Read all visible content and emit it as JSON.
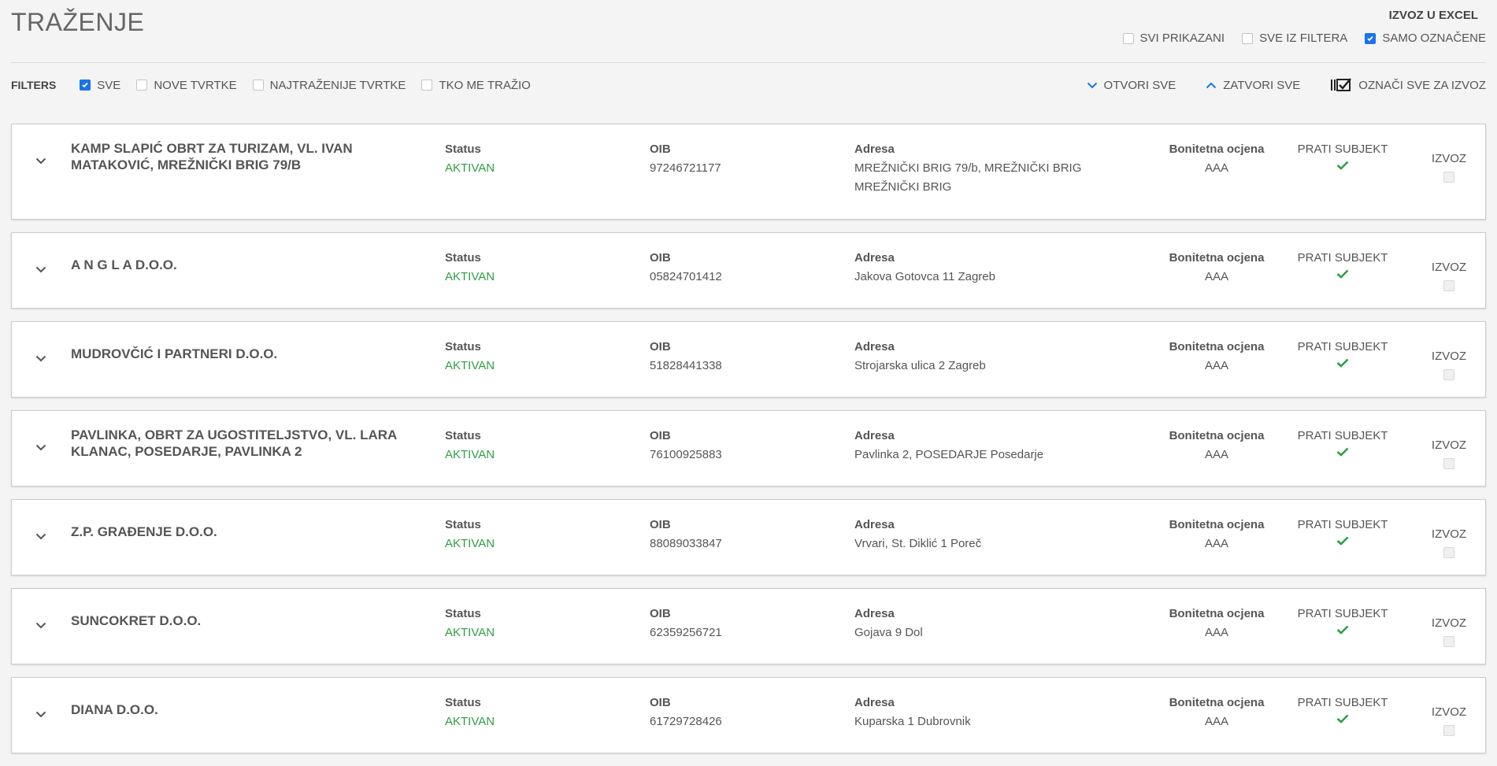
{
  "header": {
    "title": "TRAŽENJE",
    "export_title": "IZVOZ U EXCEL",
    "export_options": [
      {
        "label": "SVI PRIKAZANI",
        "checked": false
      },
      {
        "label": "SVE IZ FILTERA",
        "checked": false
      },
      {
        "label": "SAMO OZNAČENE",
        "checked": true
      }
    ]
  },
  "filters": {
    "label": "FILTERS",
    "items": [
      {
        "label": "SVE",
        "checked": true
      },
      {
        "label": "NOVE TVRTKE",
        "checked": false
      },
      {
        "label": "NAJTRAŽENIJE TVRTKE",
        "checked": false
      },
      {
        "label": "TKO ME TRAŽIO",
        "checked": false
      }
    ],
    "actions": {
      "open_all": "OTVORI SVE",
      "close_all": "ZATVORI SVE",
      "mark_all": "OZNAČI SVE ZA IZVOZ"
    }
  },
  "labels": {
    "status": "Status",
    "oib": "OIB",
    "address": "Adresa",
    "rating": "Bonitetna ocjena",
    "track": "PRATI SUBJEKT",
    "export": "IZVOZ"
  },
  "colors": {
    "accent": "#1a73e8",
    "active_status": "#2e9e46",
    "check": "#2e9e46"
  },
  "companies": [
    {
      "name": "KAMP SLAPIĆ OBRT ZA TURIZAM, VL. IVAN MATAKOVIĆ, MREŽNIČKI BRIG 79/B",
      "status": "AKTIVAN",
      "oib": "97246721177",
      "address": "MREŽNIČKI BRIG 79/b, MREŽNIČKI BRIG MREŽNIČKI BRIG",
      "rating": "AAA",
      "tracked": true
    },
    {
      "name": "A N G L A D.O.O.",
      "status": "AKTIVAN",
      "oib": "05824701412",
      "address": "Jakova Gotovca 11 Zagreb",
      "rating": "AAA",
      "tracked": true
    },
    {
      "name": "MUDROVČIĆ I PARTNERI D.O.O.",
      "status": "AKTIVAN",
      "oib": "51828441338",
      "address": "Strojarska ulica 2 Zagreb",
      "rating": "AAA",
      "tracked": true
    },
    {
      "name": "PAVLINKA, OBRT ZA UGOSTITELJSTVO, VL. LARA KLANAC, POSEDARJE, PAVLINKA 2",
      "status": "AKTIVAN",
      "oib": "76100925883",
      "address": "Pavlinka 2, POSEDARJE Posedarje",
      "rating": "AAA",
      "tracked": true
    },
    {
      "name": "Z.P. GRAĐENJE D.O.O.",
      "status": "AKTIVAN",
      "oib": "88089033847",
      "address": "Vrvari, St. Diklić 1 Poreč",
      "rating": "AAA",
      "tracked": true
    },
    {
      "name": "SUNCOKRET D.O.O.",
      "status": "AKTIVAN",
      "oib": "62359256721",
      "address": "Gojava 9 Dol",
      "rating": "AAA",
      "tracked": true
    },
    {
      "name": "DIANA D.O.O.",
      "status": "AKTIVAN",
      "oib": "61729728426",
      "address": "Kuparska 1 Dubrovnik",
      "rating": "AAA",
      "tracked": true
    }
  ]
}
